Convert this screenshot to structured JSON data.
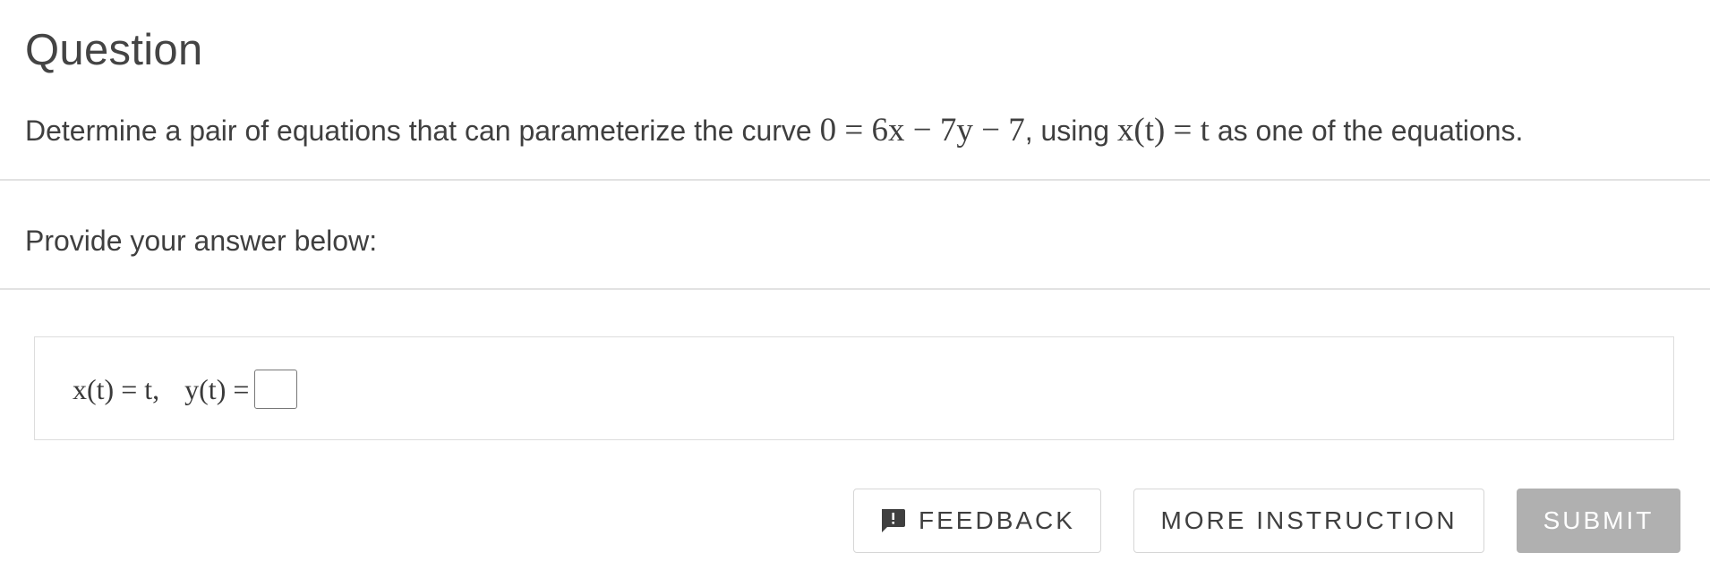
{
  "question": {
    "title": "Question",
    "text_before": "Determine a pair of equations that can parameterize the curve ",
    "equation": "0 = 6x − 7y − 7",
    "text_middle": ", using ",
    "given_equation": "x(t) = t",
    "text_after": " as one of the equations."
  },
  "answer_section": {
    "prompt": "Provide your answer below:",
    "expression_x": "x(t) = t,",
    "expression_y": "y(t) =",
    "input_value": ""
  },
  "buttons": {
    "feedback_label": "FEEDBACK",
    "more_instruction_label": "MORE INSTRUCTION",
    "submit_label": "SUBMIT"
  },
  "icons": {
    "feedback": "feedback-icon"
  },
  "colors": {
    "text": "#3f3f3f",
    "submit_disabled_bg": "#b0b0b0",
    "divider": "#e2e2e2"
  }
}
